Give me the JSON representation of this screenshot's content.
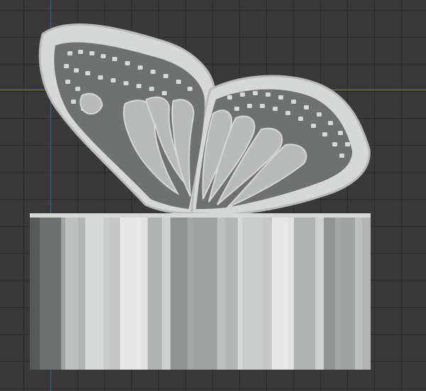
{
  "viewport": {
    "background_color": "#393939",
    "grid_color": "#2b2b2b",
    "x_axis_color": "#6e8a3a",
    "y_axis_color": "#3f5f9a"
  },
  "model": {
    "object": "butterfly-on-cylinder-base",
    "material_color": "#b9bbba",
    "shadow_color": "#6f7170",
    "highlight_color": "#d6d8d7",
    "base_stripe_colors": [
      "#cfd1d0",
      "#b2b6b5",
      "#e1e3e2",
      "#9ea3a2",
      "#c4c7c6",
      "#8f9493",
      "#d7d9d8",
      "#aeb2b1",
      "#bcc0bf",
      "#e6e7e6",
      "#a4a9a8",
      "#c9cccb"
    ]
  }
}
